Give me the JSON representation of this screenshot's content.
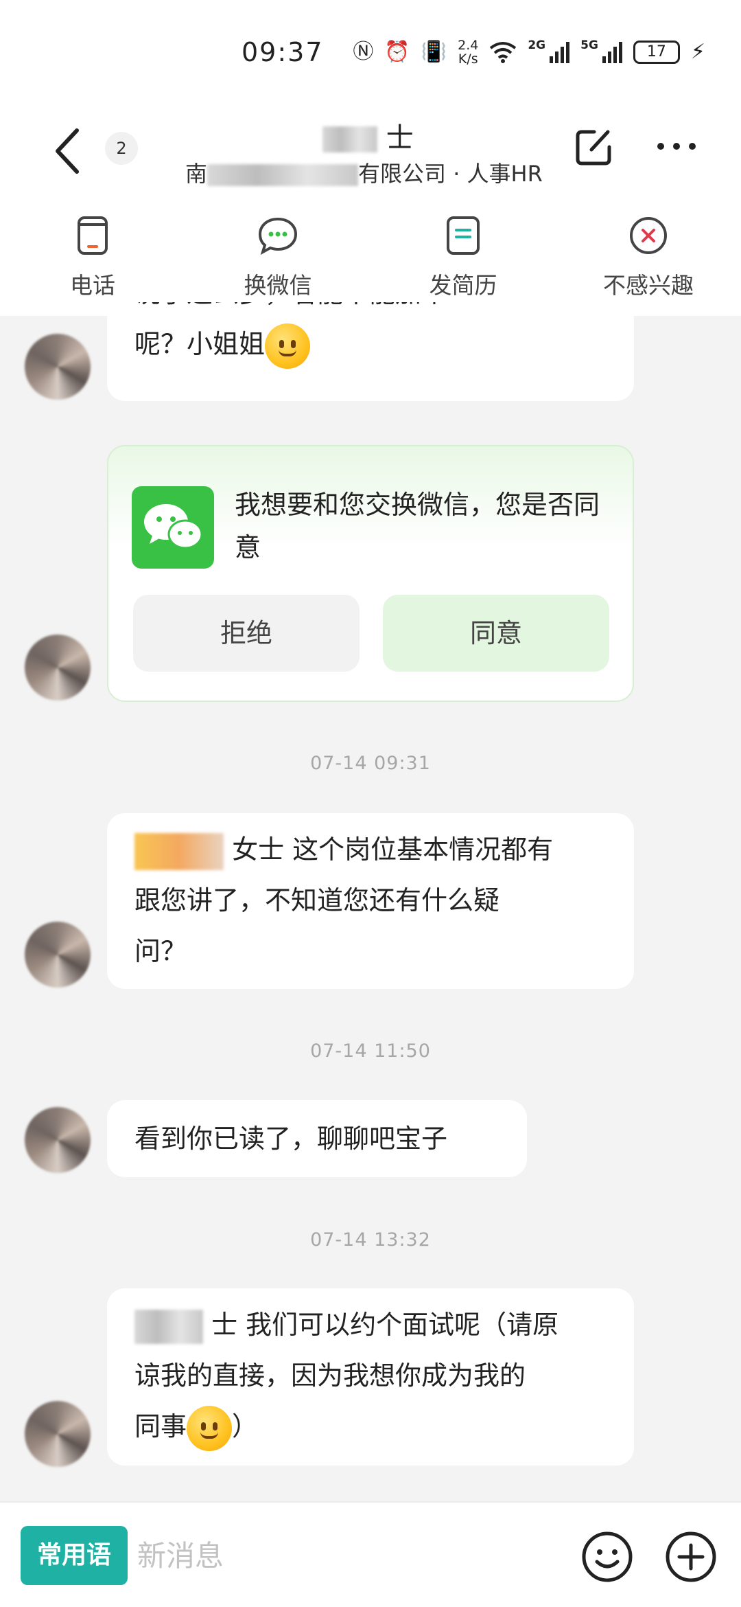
{
  "status_bar": {
    "time": "09:37",
    "speed_value": "2.4",
    "speed_unit": "K/s",
    "net1": "2G",
    "net2": "5G",
    "battery": "17"
  },
  "header": {
    "badge": "2",
    "name_suffix": "士",
    "company_prefix": "南",
    "company_suffix": "有限公司 · 人事HR"
  },
  "actions": [
    {
      "label": "电话",
      "icon": "phone-icon"
    },
    {
      "label": "换微信",
      "icon": "wechat-chat-icon"
    },
    {
      "label": "发简历",
      "icon": "resume-icon"
    },
    {
      "label": "不感兴趣",
      "icon": "close-circle-icon"
    }
  ],
  "messages": {
    "first_line1": "说了这么多，看能不能加个",
    "first_line2": "呢？小姐姐",
    "wechat_request": {
      "text": "我想要和您交换微信，您是否同意",
      "reject": "拒绝",
      "accept": "同意"
    },
    "ts1": "07-14 09:31",
    "msg2_line1": "女士 这个岗位基本情况都有",
    "msg2_line2": "跟您讲了，不知道您还有什么疑",
    "msg2_line3": "问？",
    "ts2": "07-14 11:50",
    "msg3": "看到你已读了，聊聊吧宝子",
    "ts3": "07-14 13:32",
    "msg4_line1": "士 我们可以约个面试呢（请原",
    "msg4_line2": "谅我的直接，因为我想你成为我的",
    "msg4_line3": "同事",
    "msg4_line3_end": "）"
  },
  "bottom": {
    "phrases": "常用语",
    "placeholder": "新消息"
  },
  "colors": {
    "accent": "#1fb2a4",
    "wechat_green": "#39c146",
    "reject_red": "#e0394a"
  }
}
